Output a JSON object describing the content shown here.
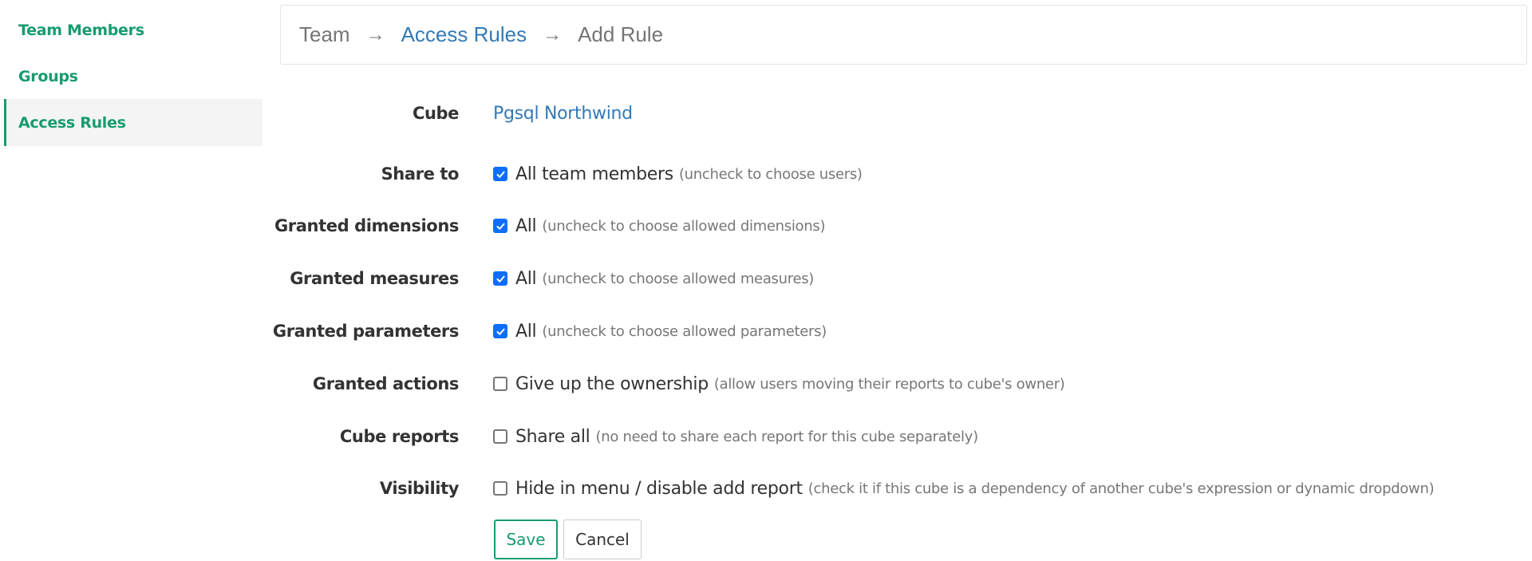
{
  "sidebar": {
    "items": [
      {
        "label": "Team Members",
        "active": false
      },
      {
        "label": "Groups",
        "active": false
      },
      {
        "label": "Access Rules",
        "active": true
      }
    ]
  },
  "breadcrumb": {
    "items": [
      "Team",
      "Access Rules",
      "Add Rule"
    ],
    "separator": "→"
  },
  "form": {
    "cube": {
      "label": "Cube",
      "value": "Pgsql Northwind"
    },
    "rows": [
      {
        "label": "Share to",
        "checked": true,
        "option": "All team members",
        "hint": "(uncheck to choose users)"
      },
      {
        "label": "Granted dimensions",
        "checked": true,
        "option": "All",
        "hint": "(uncheck to choose allowed dimensions)"
      },
      {
        "label": "Granted measures",
        "checked": true,
        "option": "All",
        "hint": "(uncheck to choose allowed measures)"
      },
      {
        "label": "Granted parameters",
        "checked": true,
        "option": "All",
        "hint": "(uncheck to choose allowed parameters)"
      },
      {
        "label": "Granted actions",
        "checked": false,
        "option": "Give up the ownership",
        "hint": "(allow users moving their reports to cube's owner)"
      },
      {
        "label": "Cube reports",
        "checked": false,
        "option": "Share all",
        "hint": "(no need to share each report for this cube separately)"
      },
      {
        "label": "Visibility",
        "checked": false,
        "option": "Hide in menu / disable add report",
        "hint": "(check it if this cube is a dependency of another cube's expression or dynamic dropdown)"
      }
    ]
  },
  "buttons": {
    "save": "Save",
    "cancel": "Cancel"
  },
  "colors": {
    "accent": "#179c6f",
    "link": "#337ab7",
    "checkbox": "#0d6efd"
  }
}
